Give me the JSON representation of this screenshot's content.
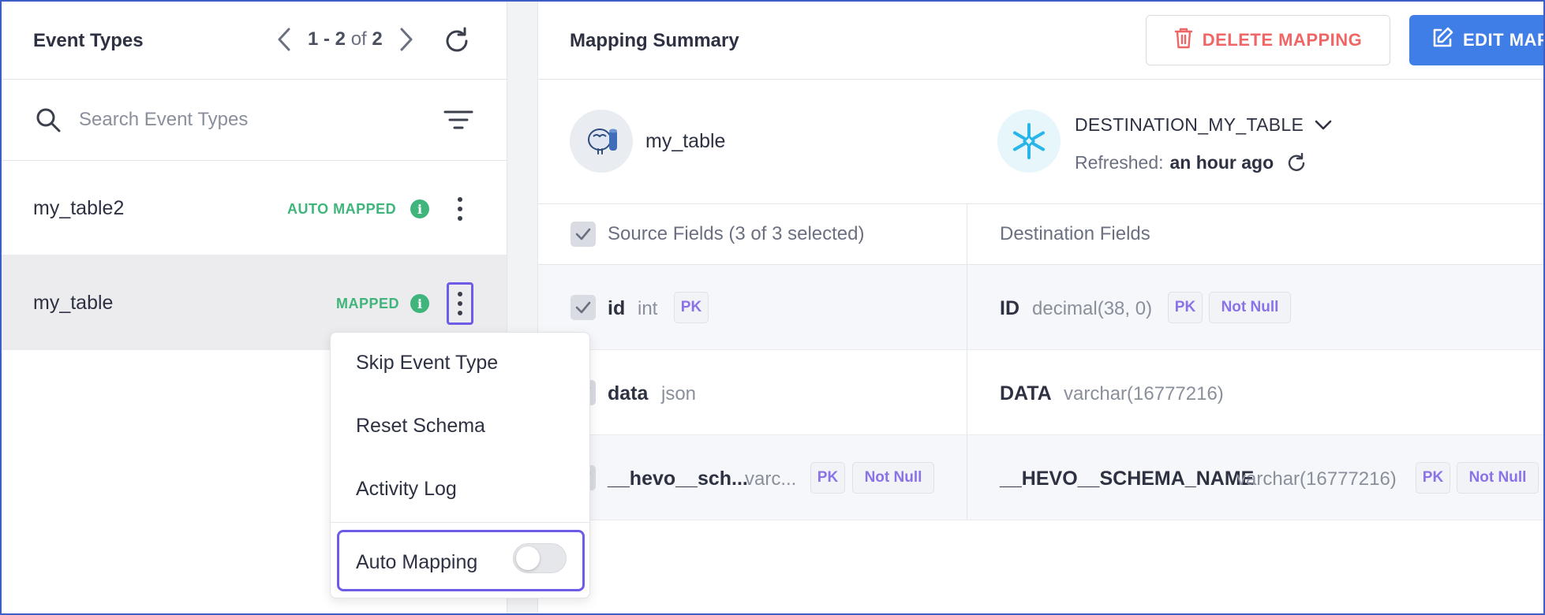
{
  "event_types": {
    "title": "Event Types",
    "pager": {
      "range": "1 - 2",
      "of": "of",
      "total": "2"
    },
    "search_placeholder": "Search Event Types",
    "items": [
      {
        "name": "my_table2",
        "status": "AUTO MAPPED",
        "info": "i"
      },
      {
        "name": "my_table",
        "status": "MAPPED",
        "info": "i"
      }
    ]
  },
  "context_menu": {
    "items": [
      "Skip Event Type",
      "Reset Schema",
      "Activity Log"
    ],
    "auto_mapping_label": "Auto Mapping",
    "auto_mapping_enabled": false
  },
  "mapping_summary": {
    "title": "Mapping Summary",
    "delete_label": "DELETE MAPPING",
    "edit_label": "EDIT MAPPING",
    "source": {
      "name": "my_table",
      "icon": "postgres-icon"
    },
    "destination": {
      "name": "DESTINATION_MY_TABLE",
      "icon": "snowflake-icon",
      "refreshed_label": "Refreshed:",
      "refreshed_value": "an hour ago"
    },
    "headers": {
      "source": "Source Fields (3 of 3 selected)",
      "destination": "Destination Fields"
    },
    "rows": [
      {
        "src_name": "id",
        "src_type": "int",
        "src_tags": [
          "PK"
        ],
        "dst_name": "ID",
        "dst_type": "decimal(38, 0)",
        "dst_tags": [
          "PK",
          "Not Null"
        ]
      },
      {
        "src_name": "data",
        "src_type": "json",
        "src_tags": [],
        "dst_name": "DATA",
        "dst_type": "varchar(16777216)",
        "dst_tags": []
      },
      {
        "src_name": "__hevo__sch...",
        "src_type": "varc...",
        "src_tags": [
          "PK",
          "Not Null"
        ],
        "dst_name": "__HEVO__SCHEMA_NAME",
        "dst_type": "varchar(16777216)",
        "dst_tags": [
          "PK",
          "Not Null"
        ]
      }
    ]
  },
  "colors": {
    "accent_purple": "#6c5ce7",
    "mapped_green": "#3fb47b",
    "delete_red": "#f06565",
    "edit_blue": "#3f7ee6",
    "tag_purple": "#8a72e8"
  }
}
